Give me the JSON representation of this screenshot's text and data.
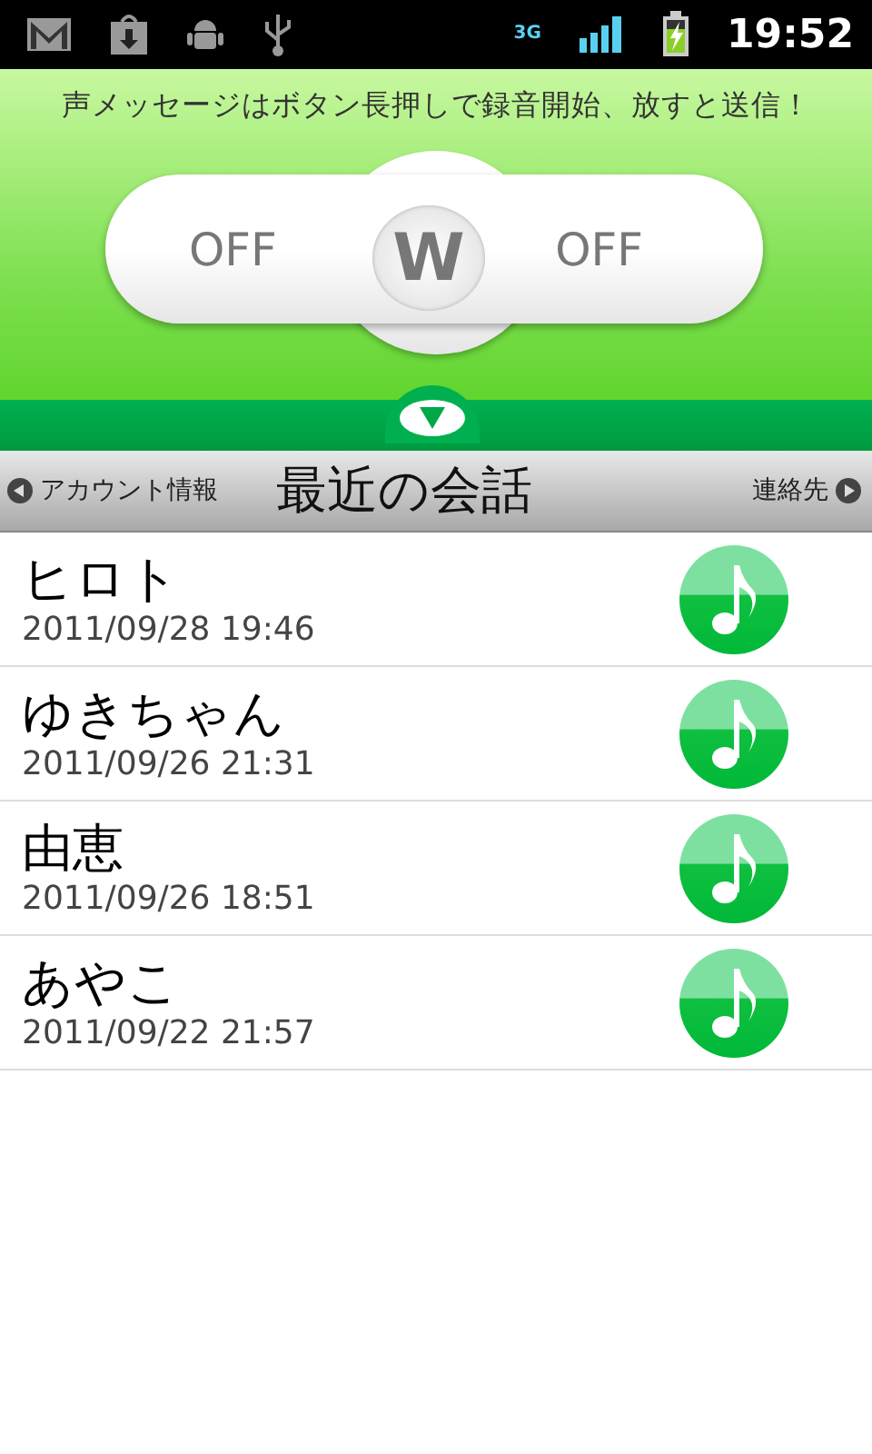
{
  "status_bar": {
    "time": "19:52",
    "network": "3G"
  },
  "recorder": {
    "hint": "声メッセージはボタン長押しで録音開始、放すと送信！",
    "left_label": "OFF",
    "logo": "W",
    "right_label": "OFF"
  },
  "nav": {
    "back": "アカウント情報",
    "title": "最近の会話",
    "forward": "連絡先"
  },
  "conversations": [
    {
      "name": "ヒロト",
      "time": "2011/09/28 19:46"
    },
    {
      "name": "ゆきちゃん",
      "time": "2011/09/26 21:31"
    },
    {
      "name": "由恵",
      "time": "2011/09/26 18:51"
    },
    {
      "name": "あやこ",
      "time": "2011/09/22 21:57"
    }
  ]
}
